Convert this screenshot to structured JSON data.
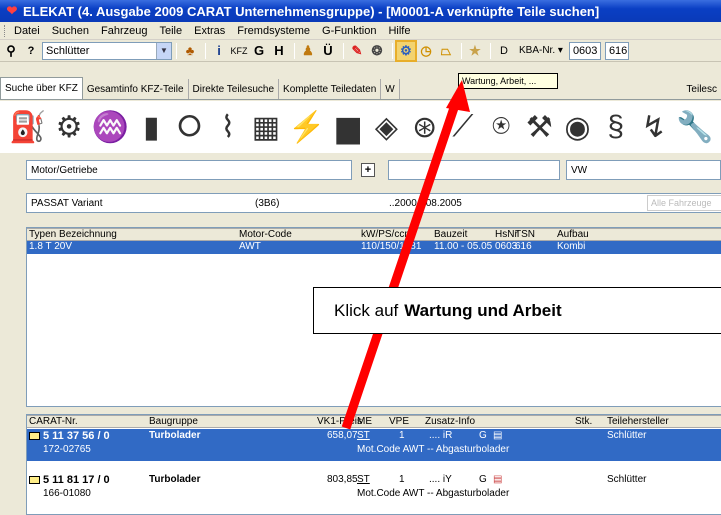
{
  "window": {
    "title": "ELEKAT (4. Ausgabe 2009 CARAT Unternehmensgruppe) - [M0001-A verknüpfte Teile suchen]"
  },
  "menu": [
    "Datei",
    "Suchen",
    "Fahrzeug",
    "Teile",
    "Extras",
    "Fremdsysteme",
    "G-Funktion",
    "Hilfe"
  ],
  "toolbar": {
    "manufacturer": "Schlütter",
    "kfz_label": "KFZ",
    "g": "G",
    "h": "H",
    "u": "Ü",
    "d": "D",
    "kba_label": "KBA-Nr.",
    "kba_hsn": "0603",
    "kba_tsn": "616"
  },
  "tooltip": "Wartung, Arbeit, ...",
  "tabs": [
    "Suche über KFZ",
    "Gesamtinfo KFZ-Teile",
    "Direkte Teilesuche",
    "Komplette Teiledaten",
    "W",
    "Teilesc"
  ],
  "icons": [
    "engine-icon",
    "gearbox-icon",
    "exhaust-icon",
    "filter-icon",
    "belt-icon",
    "suspension-icon",
    "cooling-icon",
    "ignition-icon",
    "battery-icon",
    "clutch-icon",
    "wheel-icon",
    "wiper-icon",
    "steering-icon",
    "tool-icon",
    "brake-icon",
    "spring-icon",
    "hose-icon",
    "wrench-icon"
  ],
  "search": {
    "group": "Motor/Getriebe",
    "brand": "VW",
    "model": "PASSAT Variant",
    "model_code": "(3B6)",
    "period": "..2000 - 08.2005",
    "all_vehicles": "Alle Fahrzeuge"
  },
  "vehicle_grid": {
    "headers": [
      "Typen Bezeichnung",
      "Motor-Code",
      "kW/PS/ccm",
      "Bauzeit",
      "HsNr",
      "TSN",
      "Aufbau"
    ],
    "rows": [
      {
        "type": "1.8 T 20V",
        "motor": "AWT",
        "power": "110/150/1781",
        "period": "11.00 - 05.05",
        "hsn": "0603",
        "tsn": "616",
        "body": "Kombi"
      }
    ]
  },
  "parts_grid": {
    "headers": [
      "CARAT-Nr.",
      "Baugruppe",
      "VK1-Preis",
      "ME",
      "VPE",
      "Zusatz-Info",
      "Stk.",
      "Teilehersteller"
    ],
    "rows": [
      {
        "nr": "5 11 37 56 / 0",
        "sub": "172-02765",
        "group": "Turbolader",
        "price": "658,07",
        "me": "ST",
        "vpe": "1",
        "info": ".... iR",
        "g": "G",
        "manufacturer": "Schlütter",
        "note": "Mot.Code AWT -- Abgasturbolader"
      },
      {
        "nr": "5 11 81 17 / 0",
        "sub": "166-01080",
        "group": "Turbolader",
        "price": "803,85",
        "me": "ST",
        "vpe": "1",
        "info": ".... iY",
        "g": "G",
        "manufacturer": "Schlütter",
        "note": "Mot.Code AWT -- Abgasturbolader"
      }
    ]
  },
  "callout": {
    "prefix": "Klick auf",
    "bold": "Wartung und Arbeit"
  },
  "colors": {
    "selection": "#316ac5",
    "titlebar": "#0a3fc4",
    "arrow": "#ff0000",
    "highlight": "#f3d36f"
  }
}
